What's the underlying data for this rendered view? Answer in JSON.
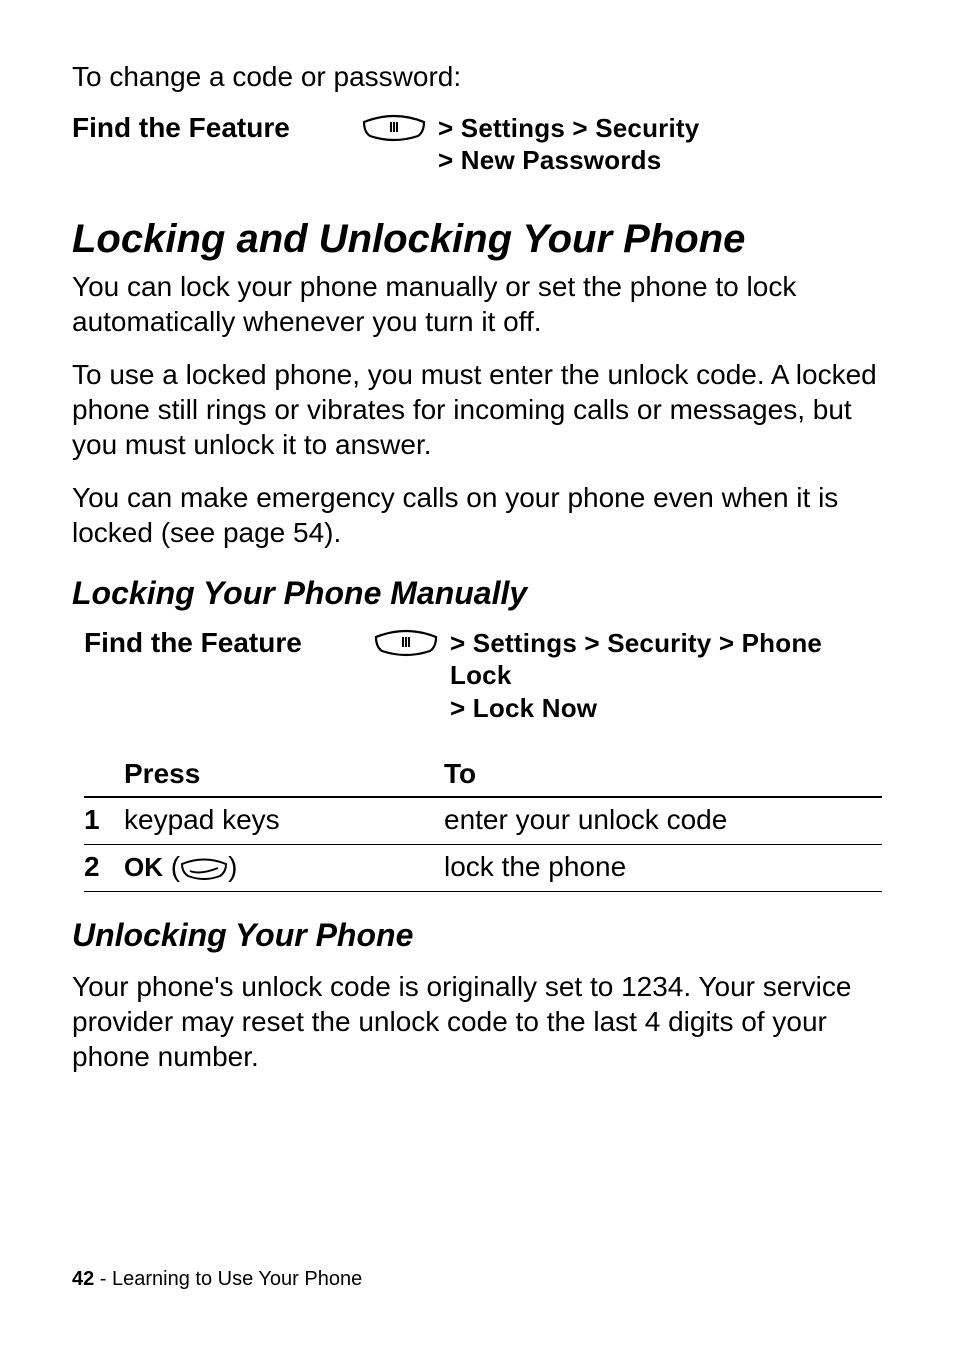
{
  "intro": "To change a code or password:",
  "find1": {
    "label": "Find the Feature",
    "path_line1": "> Settings > Security",
    "path_line2": "> New Passwords"
  },
  "section1": {
    "heading": "Locking and Unlocking Your Phone",
    "p1": "You can lock your phone manually or set the phone to lock automatically whenever you turn it off.",
    "p2": "To use a locked phone, you must enter the unlock code. A locked phone still rings or vibrates for incoming calls or messages, but you must unlock it to answer.",
    "p3": "You can make emergency calls on your phone even when it is locked (see page 54)."
  },
  "subsection1": {
    "heading": "Locking Your Phone Manually",
    "find": {
      "label": "Find the Feature",
      "path_line1": "> Settings > Security > Phone Lock",
      "path_line2": "> Lock Now"
    },
    "table": {
      "head_press": "Press",
      "head_to": "To",
      "rows": [
        {
          "n": "1",
          "press": "keypad keys",
          "to": "enter your unlock code"
        },
        {
          "n": "2",
          "press_prefix": "OK",
          "press_paren_open": " (",
          "press_paren_close": ")",
          "to": "lock the phone"
        }
      ]
    }
  },
  "subsection2": {
    "heading": "Unlocking Your Phone",
    "p1": "Your phone's unlock code is originally set to 1234. Your service provider may reset the unlock code to the last 4 digits of your phone number."
  },
  "footer": {
    "page": "42",
    "sep": " - ",
    "title": "Learning to Use Your Phone"
  }
}
